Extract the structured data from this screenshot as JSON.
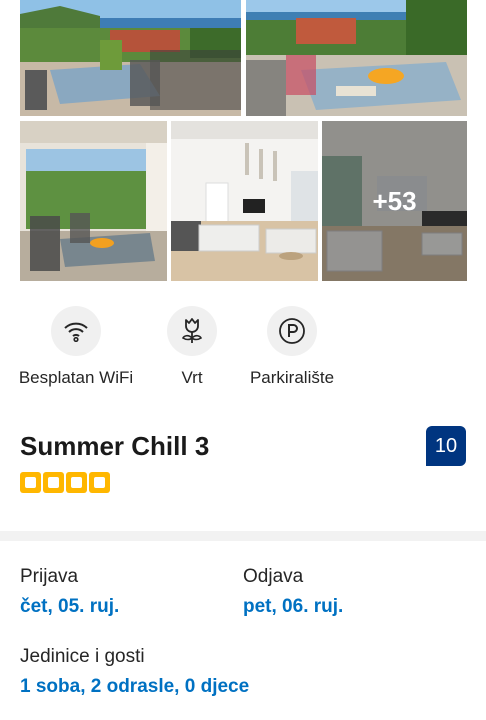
{
  "gallery": {
    "more_count": "+53",
    "photos": [
      "terrace-sea-view",
      "terrace-table-fruit",
      "covered-patio",
      "living-room",
      "living-dining"
    ]
  },
  "facilities": [
    {
      "label": "Besplatan WiFi",
      "icon": "wifi-icon"
    },
    {
      "label": "Vrt",
      "icon": "flower-icon"
    },
    {
      "label": "Parkiralište",
      "icon": "parking-icon"
    }
  ],
  "property": {
    "name": "Summer Chill 3",
    "score": "10",
    "stars": 4
  },
  "booking": {
    "checkin_label": "Prijava",
    "checkin_value": "čet, 05. ruj.",
    "checkout_label": "Odjava",
    "checkout_value": "pet, 06. ruj.",
    "units_label": "Jedinice i gosti",
    "units_value": "1 soba, 2 odrasle, 0 djece"
  },
  "colors": {
    "link": "#0071c2",
    "score_bg": "#003580",
    "star": "#ffb700"
  }
}
